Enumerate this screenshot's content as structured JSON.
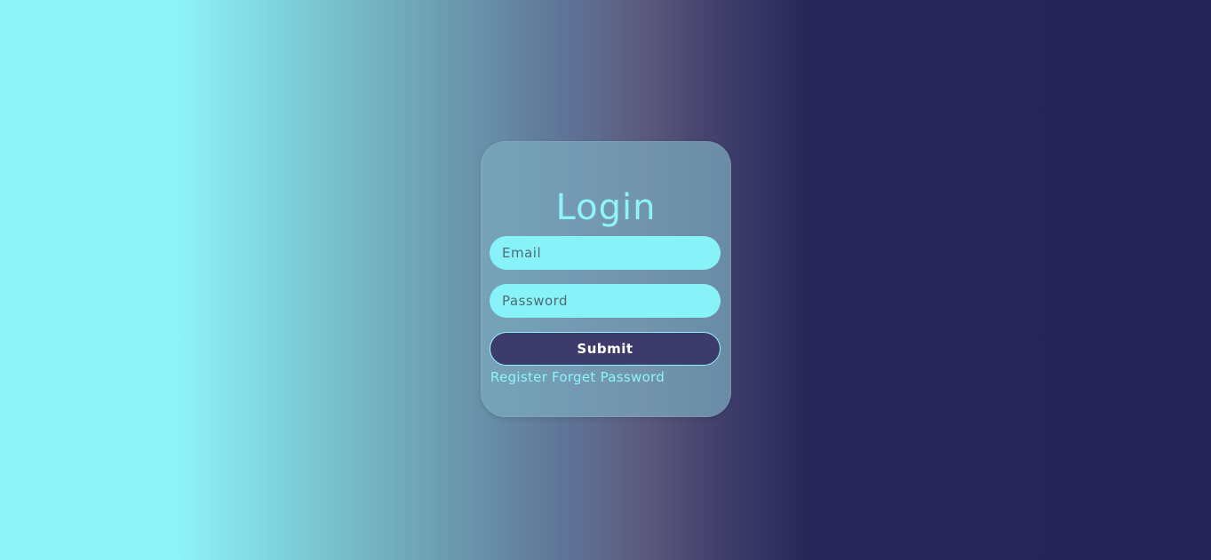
{
  "login": {
    "title": "Login",
    "email_placeholder": "Email",
    "email_value": "",
    "password_placeholder": "Password",
    "password_value": "",
    "submit_label": "Submit",
    "register_link": "Register",
    "forget_password_link": "Forget Password"
  },
  "colors": {
    "accent": "#8ef4fa",
    "button_bg": "#3d3b6b",
    "background_left": "#8ef6fa",
    "background_right": "#252457"
  }
}
